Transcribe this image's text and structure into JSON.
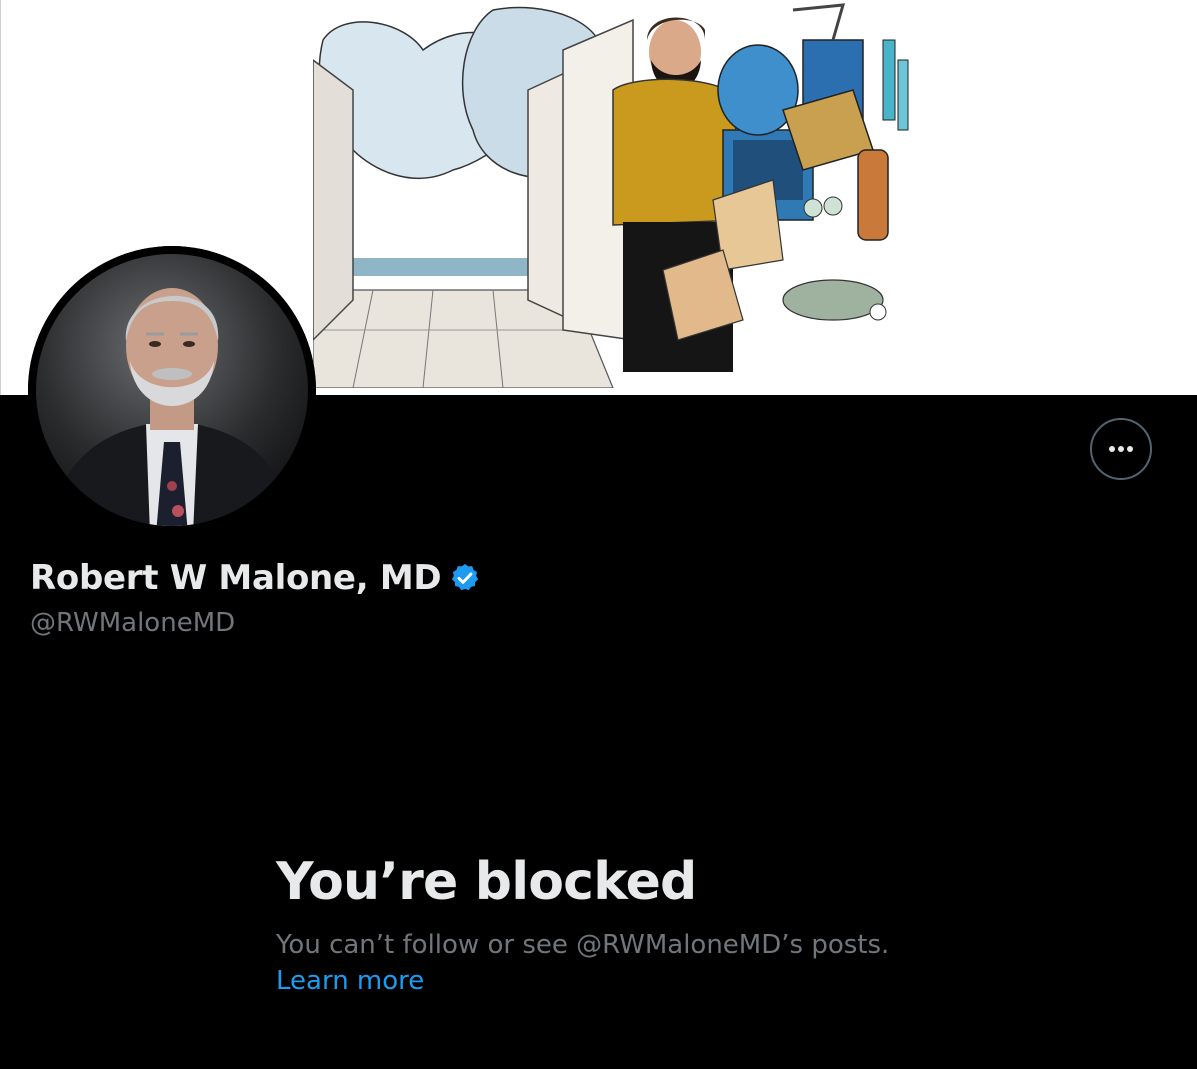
{
  "banner": {
    "description_icon": "illustration-banner"
  },
  "profile": {
    "display_name": "Robert W Malone, MD",
    "handle": "@RWMaloneMD",
    "verified_icon": "verified-badge-icon",
    "more_icon": "more-dots-icon"
  },
  "blocked": {
    "title": "You’re blocked",
    "description": "You can’t follow or see @RWMaloneMD’s posts.",
    "link": "Learn more"
  },
  "colors": {
    "background": "#000000",
    "primary_text": "#e7e9ea",
    "secondary_text": "#71767b",
    "accent": "#1d9bf0",
    "border": "#536471"
  }
}
